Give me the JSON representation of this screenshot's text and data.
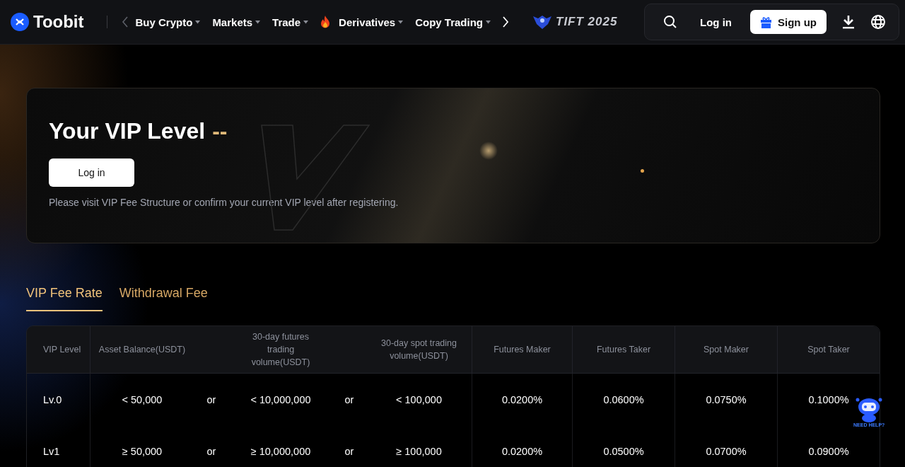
{
  "header": {
    "logo": "Toobit",
    "nav": [
      {
        "label": "Buy Crypto",
        "has_menu": true,
        "hot": false
      },
      {
        "label": "Markets",
        "has_menu": true,
        "hot": false
      },
      {
        "label": "Trade",
        "has_menu": true,
        "hot": false
      },
      {
        "label": "Derivatives",
        "has_menu": true,
        "hot": true
      },
      {
        "label": "Copy Trading",
        "has_menu": true,
        "hot": false
      }
    ],
    "event_badge": "TIFT 2025",
    "login": "Log in",
    "signup": "Sign up"
  },
  "banner": {
    "title": "Your VIP Level",
    "level": "--",
    "login_button": "Log in",
    "note": "Please visit VIP Fee Structure or confirm your current VIP level after registering."
  },
  "tabs": [
    {
      "label": "VIP Fee Rate",
      "selected": true
    },
    {
      "label": "Withdrawal Fee",
      "selected": false
    }
  ],
  "table": {
    "columns": [
      "VIP Level",
      "Asset Balance(USDT)",
      "",
      "30-day futures trading volume(USDT)",
      "",
      "30-day spot trading volume(USDT)",
      "Futures Maker",
      "Futures Taker",
      "Spot Maker",
      "Spot Taker"
    ],
    "rows": [
      [
        "Lv.0",
        "< 50,000",
        "or",
        "< 10,000,000",
        "or",
        "< 100,000",
        "0.0200%",
        "0.0600%",
        "0.0750%",
        "0.1000%"
      ],
      [
        "Lv1",
        "≥ 50,000",
        "or",
        "≥ 10,000,000",
        "or",
        "≥ 100,000",
        "0.0200%",
        "0.0500%",
        "0.0700%",
        "0.0900%"
      ]
    ]
  },
  "help_bot": {
    "label": "NEED HELP?"
  }
}
